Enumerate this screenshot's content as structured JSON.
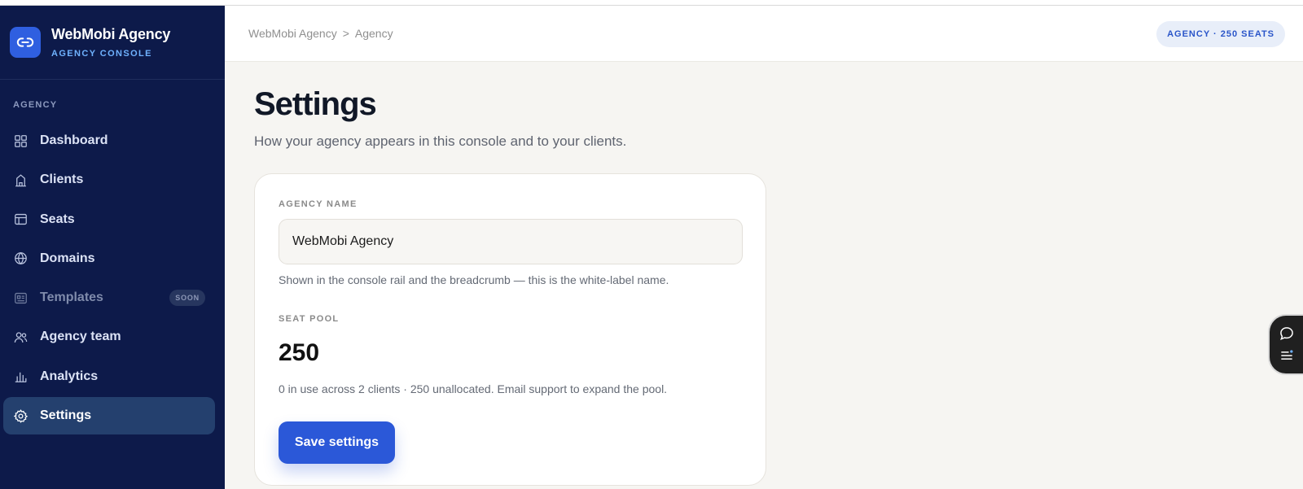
{
  "brand": {
    "name": "WebMobi Agency",
    "subtitle": "AGENCY CONSOLE"
  },
  "sidebar": {
    "section_label": "AGENCY",
    "items": [
      {
        "label": "Dashboard",
        "icon": "grid-icon",
        "state": "normal"
      },
      {
        "label": "Clients",
        "icon": "building-icon",
        "state": "normal"
      },
      {
        "label": "Seats",
        "icon": "table-icon",
        "state": "normal"
      },
      {
        "label": "Domains",
        "icon": "globe-icon",
        "state": "normal"
      },
      {
        "label": "Templates",
        "icon": "template-icon",
        "state": "disabled",
        "badge": "SOON"
      },
      {
        "label": "Agency team",
        "icon": "users-icon",
        "state": "normal"
      },
      {
        "label": "Analytics",
        "icon": "bar-chart-icon",
        "state": "normal"
      },
      {
        "label": "Settings",
        "icon": "settings-icon",
        "state": "active"
      }
    ]
  },
  "header": {
    "breadcrumb": {
      "root": "WebMobi Agency",
      "separator": ">",
      "current": "Agency"
    },
    "seats_badge": "AGENCY · 250 SEATS"
  },
  "main": {
    "title": "Settings",
    "subtitle": "How your agency appears in this console and to your clients.",
    "form": {
      "agency_name_label": "AGENCY NAME",
      "agency_name_value": "WebMobi Agency",
      "agency_name_help": "Shown in the console rail and the breadcrumb — this is the white-label name.",
      "seat_pool_label": "SEAT POOL",
      "seat_pool_value": "250",
      "seat_pool_help": "0 in use across 2 clients · 250 unallocated. Email support to expand the pool.",
      "save_label": "Save settings"
    }
  },
  "floating_widget": {
    "icons": [
      "chat-icon",
      "menu-notification-icon"
    ]
  },
  "colors": {
    "sidebar_bg": "#0d1a4a",
    "active_item_bg": "#24406e",
    "accent": "#2b58d8",
    "brand_subtitle": "#6fb2ff",
    "page_bg": "#f6f5f2"
  }
}
